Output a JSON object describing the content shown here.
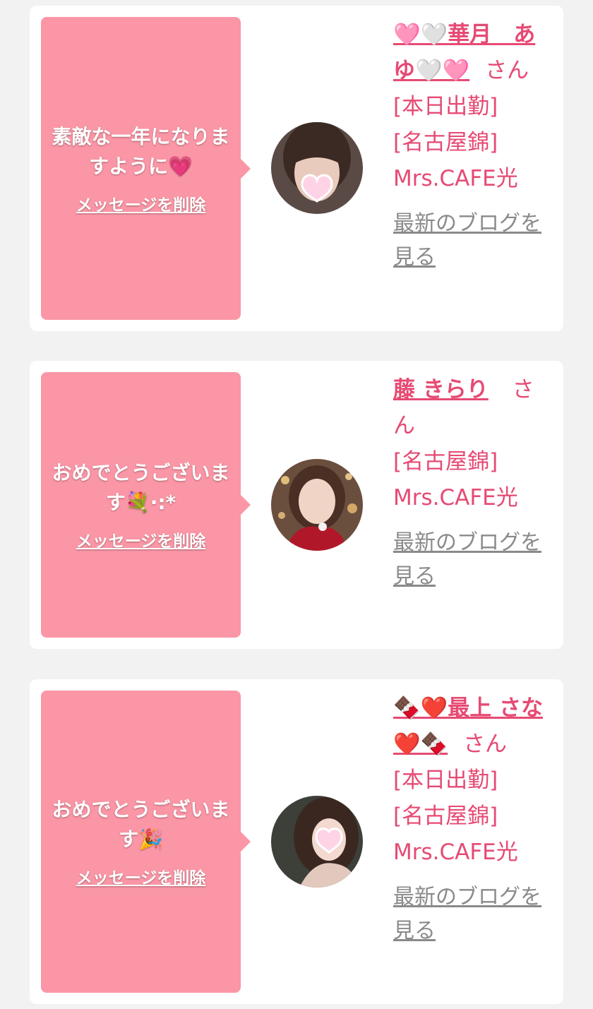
{
  "cards": [
    {
      "message": "素敵な一年になりますように💗",
      "delete_label": "メッセージを削除",
      "name": "🩷🤍華月　あゆ🤍🩷",
      "honorific": "さん",
      "status_today": "[本日出勤]",
      "shop": "[名古屋錦] Mrs.CAFE光",
      "blog_label": "最新のブログを見る"
    },
    {
      "message": "おめでとうございます💐·:*",
      "delete_label": "メッセージを削除",
      "name": "藤 きらり",
      "honorific": "さん",
      "status_today": "",
      "shop": "[名古屋錦] Mrs.CAFE光",
      "blog_label": "最新のブログを見る"
    },
    {
      "message": "おめでとうございます🎉",
      "delete_label": "メッセージを削除",
      "name": "🍫❤️最上 さな❤️🍫",
      "honorific": "さん",
      "status_today": "[本日出勤]",
      "shop": "[名古屋錦] Mrs.CAFE光",
      "blog_label": "最新のブログを見る"
    }
  ],
  "colors": {
    "background": "#f2f2f2",
    "card": "#ffffff",
    "bubble": "#fb96a6",
    "name_text": "#e64a73",
    "blog_link": "#8a8a8a"
  }
}
